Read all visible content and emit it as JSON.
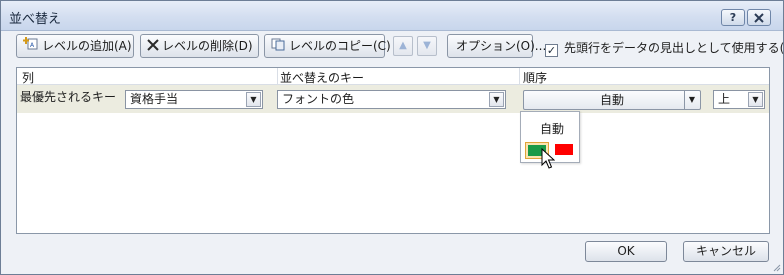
{
  "window": {
    "title": "並べ替え",
    "help_label": "?",
    "close_label": "X"
  },
  "toolbar": {
    "add_level": "レベルの追加(A)",
    "delete_level": "レベルの削除(D)",
    "copy_level": "レベルのコピー(C)",
    "move_up": "▲",
    "move_down": "▼",
    "options": "オプション(O)...",
    "header_checkbox_label": "先頭行をデータの見出しとして使用する(H)",
    "header_checked": true,
    "check_mark": "✓"
  },
  "grid": {
    "headers": {
      "column": "列",
      "sort_on": "並べ替えのキー",
      "order": "順序"
    },
    "row": {
      "label": "最優先されるキー",
      "column_value": "資格手当",
      "sort_on_value": "フォントの色",
      "order_value": "自動",
      "order_direction": "上"
    }
  },
  "color_popup": {
    "label": "自動",
    "swatches": [
      {
        "name": "green",
        "color": "#1a9a47",
        "selected": true
      },
      {
        "name": "red",
        "color": "#ff0000",
        "selected": false
      }
    ]
  },
  "footer": {
    "ok": "OK",
    "cancel": "キャンセル"
  },
  "dropdown_glyph": "▼"
}
